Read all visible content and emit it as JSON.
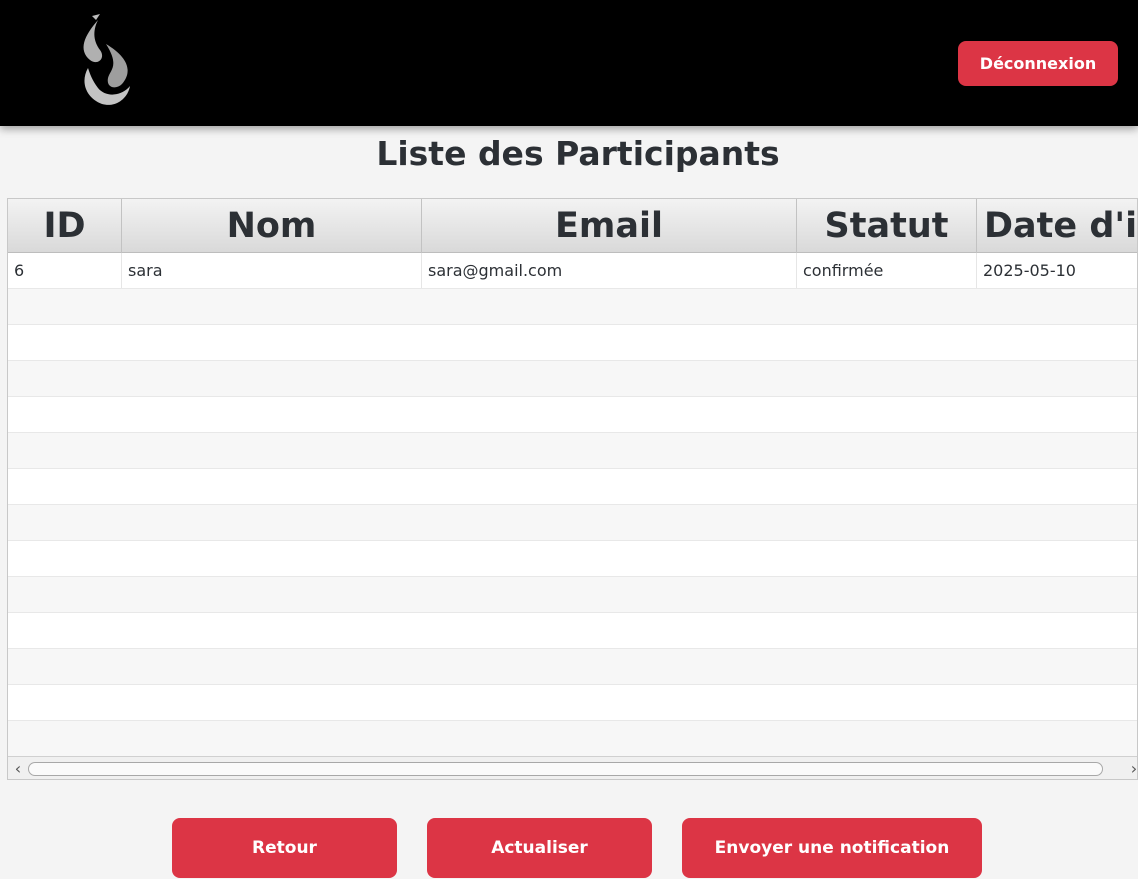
{
  "header": {
    "logout_label": "Déconnexion"
  },
  "page": {
    "title": "Liste des Participants"
  },
  "table": {
    "columns": [
      "ID",
      "Nom",
      "Email",
      "Statut",
      "Date d'in"
    ],
    "rows": [
      [
        "6",
        "sara",
        "sara@gmail.com",
        "confirmée",
        "2025-05-10"
      ]
    ]
  },
  "actions": {
    "back_label": "Retour",
    "refresh_label": "Actualiser",
    "notify_label": "Envoyer une notification"
  },
  "colors": {
    "accent": "#dc3545",
    "topbar": "#000000"
  }
}
